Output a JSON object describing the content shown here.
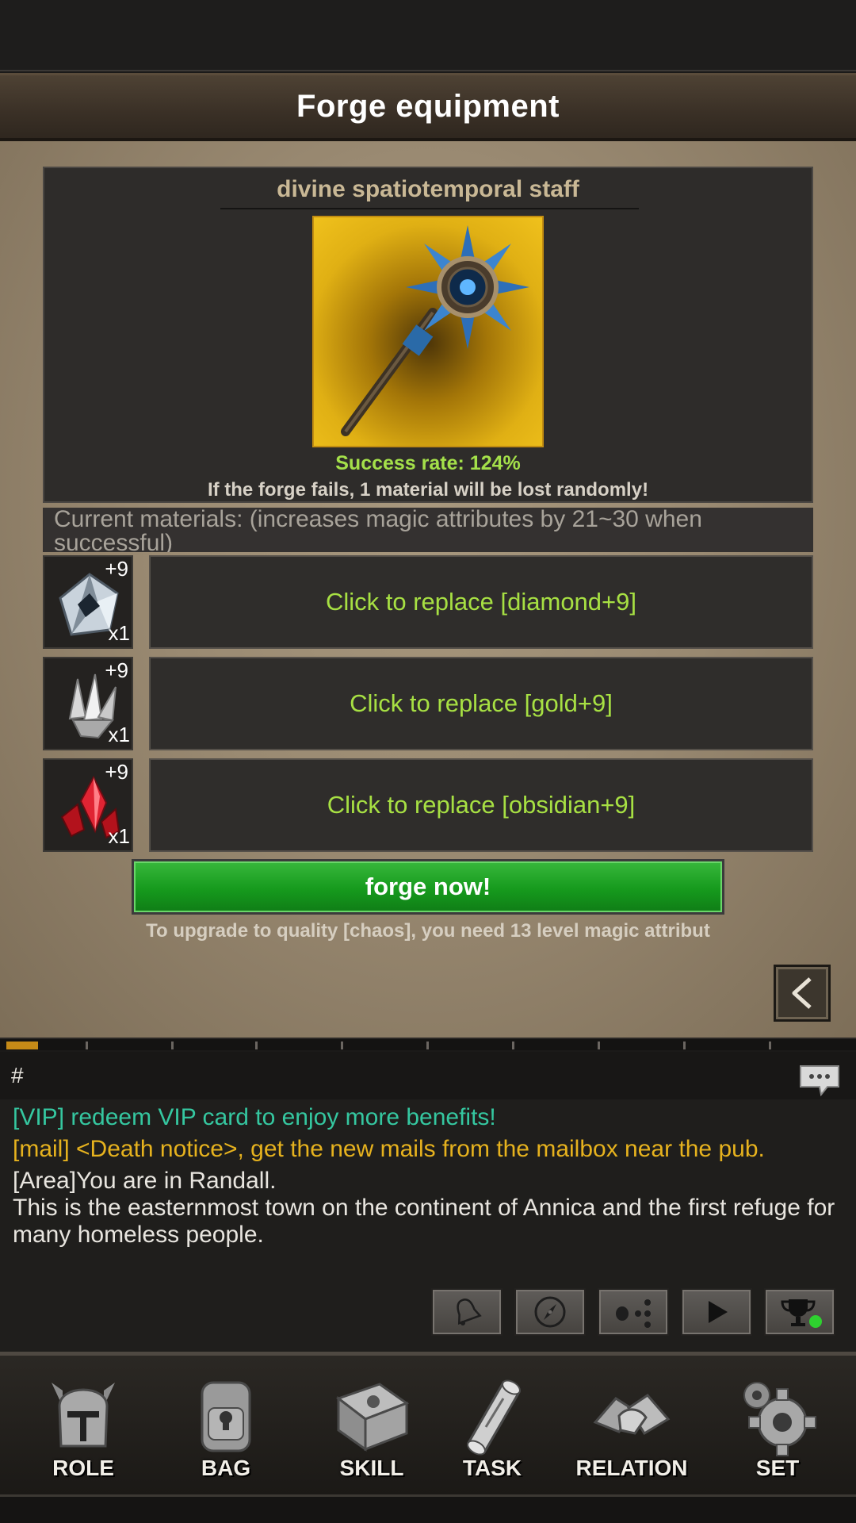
{
  "title": "Forge equipment",
  "item": {
    "name": "divine spatiotemporal staff",
    "success_rate": "Success rate: 124%",
    "fail_note": "If the forge fails, 1 material will be lost randomly!"
  },
  "current_materials": "Current materials: (increases magic attributes by 21~30 when successful)",
  "materials": [
    {
      "level": "+9",
      "qty": "x1",
      "replace_label": "Click to replace [diamond+9]",
      "icon": "diamond-icon"
    },
    {
      "level": "+9",
      "qty": "x1",
      "replace_label": "Click to replace [gold+9]",
      "icon": "gold-crystal-icon"
    },
    {
      "level": "+9",
      "qty": "x1",
      "replace_label": "Click to replace [obsidian+9]",
      "icon": "obsidian-crystal-icon"
    }
  ],
  "forge_button": "forge now!",
  "upgrade_note": "To upgrade to quality [chaos], you need 13 level magic attribut",
  "chat": {
    "channel": "#",
    "lines": [
      "[VIP] redeem VIP card to enjoy more benefits!",
      "[mail] <Death notice>,  get the new mails from the mailbox near the pub.",
      "[Area]You are in Randall.\nThis is the easternmost town on the continent of Annica and the first refuge for many homeless people."
    ]
  },
  "quick_buttons": [
    "bell-icon",
    "compass-icon",
    "dots-icon",
    "play-icon",
    "trophy-icon"
  ],
  "nav": [
    {
      "label": "ROLE",
      "icon": "helmet-icon"
    },
    {
      "label": "BAG",
      "icon": "backpack-icon"
    },
    {
      "label": "SKILL",
      "icon": "skill-book-icon"
    },
    {
      "label": "TASK",
      "icon": "scroll-icon"
    },
    {
      "label": "RELATION",
      "icon": "handshake-icon"
    },
    {
      "label": "SET",
      "icon": "gear-icon"
    }
  ],
  "colors": {
    "accent_green": "#a7e043",
    "forge_button": "#169a1d",
    "vip_text": "#35c7a0",
    "mail_text": "#e6b21e"
  },
  "progress_fraction": 0.04
}
